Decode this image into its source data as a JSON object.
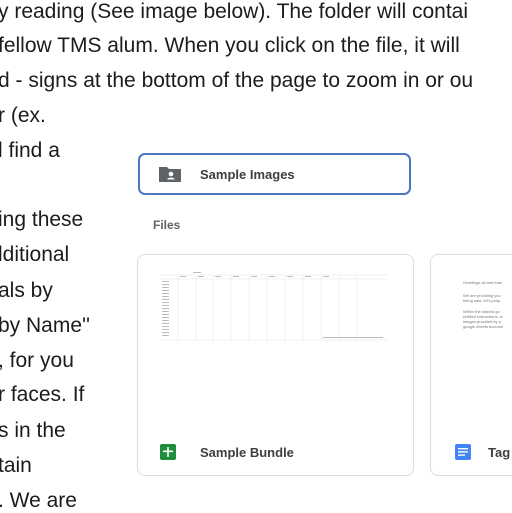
{
  "document": {
    "lines": [
      "y reading (See image below). The folder will contai",
      "fellow TMS alum. When you click on the file, it will",
      "d - signs at the bottom of the page to zoom in or ou",
      "r (ex.",
      "l find a",
      "ing these",
      "lditional",
      "als by",
      "by Name''",
      ", for you",
      "r faces. If",
      "s in the",
      "tain",
      ". We are"
    ]
  },
  "drive": {
    "folder_label": "Sample Images",
    "files_heading": "Files",
    "files": [
      {
        "name": "Sample Bundle",
        "type": "spreadsheet",
        "icon": "sheets-icon"
      },
      {
        "name": "Tag",
        "type": "document",
        "icon": "docs-icon",
        "preview_lines": [
          "Greetings all and than",
          "We are providing you",
          "being said, let's jump",
          "Within the shared go",
          "entitled Instructions, w",
          "images provided by p",
          "google sheets docume"
        ]
      }
    ]
  },
  "colors": {
    "accent": "#4a78c2",
    "sheets_green": "#1e8e3e",
    "docs_blue": "#4285f4"
  }
}
